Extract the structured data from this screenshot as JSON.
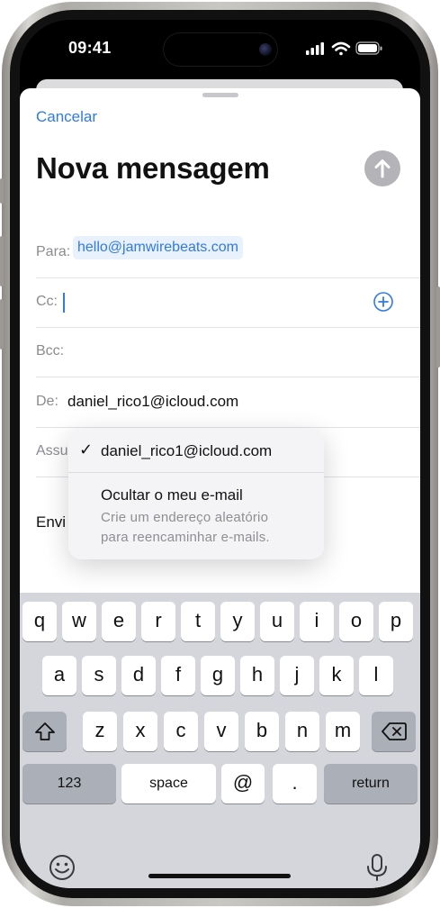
{
  "status_bar": {
    "time": "09:41"
  },
  "compose": {
    "cancel_label": "Cancelar",
    "title": "Nova mensagem",
    "to_label": "Para:",
    "to_value": "hello@jamwirebeats.com",
    "cc_label": "Cc:",
    "bcc_label": "Bcc:",
    "from_label": "De:",
    "from_value": "daniel_rico1@icloud.com",
    "subject_label": "Assu",
    "body_partial": "Envi"
  },
  "from_menu": {
    "selected_option": "daniel_rico1@icloud.com",
    "check_mark": "✓",
    "hide_title": "Ocultar o meu e-mail",
    "hide_subtitle_line1": "Crie um endereço aleatório",
    "hide_subtitle_line2": "para reencaminhar e-mails."
  },
  "keyboard": {
    "row1": [
      "q",
      "w",
      "e",
      "r",
      "t",
      "y",
      "u",
      "i",
      "o",
      "p"
    ],
    "row2": [
      "a",
      "s",
      "d",
      "f",
      "g",
      "h",
      "j",
      "k",
      "l"
    ],
    "row3": [
      "z",
      "x",
      "c",
      "v",
      "b",
      "n",
      "m"
    ],
    "numbers_label": "123",
    "space_label": "space",
    "at_label": "@",
    "dot_label": ".",
    "return_label": "return"
  },
  "colors": {
    "accent": "#2f7ae5",
    "keyboard_bg": "#d4d6dc",
    "send_disabled": "#b4b4b8"
  },
  "icons": [
    "cellular-signal-icon",
    "wifi-icon",
    "battery-icon",
    "send-arrow-icon",
    "add-contact-icon",
    "shift-icon",
    "delete-icon",
    "emoji-icon",
    "microphone-icon"
  ]
}
